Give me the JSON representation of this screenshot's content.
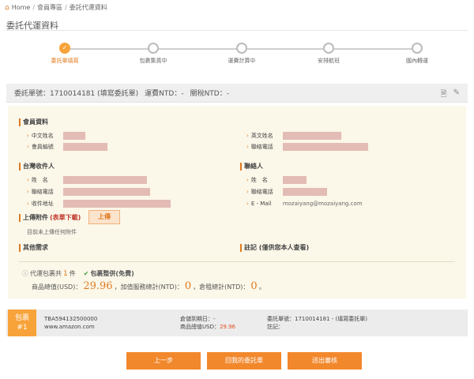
{
  "breadcrumb": {
    "home": "Home",
    "members": "會員專區",
    "current": "委託代運資料"
  },
  "page_title": "委託代運資料",
  "steps": [
    {
      "label": "委託單填寫",
      "active": true
    },
    {
      "label": "包裹集貨中",
      "active": false
    },
    {
      "label": "運費計算中",
      "active": false
    },
    {
      "label": "安排航班",
      "active": false
    },
    {
      "label": "國內轉運",
      "active": false
    }
  ],
  "order_bar": {
    "order_no": "委託單號：1710014181 (填寫委託單)",
    "freight": "運費NTD：-",
    "tax": "關稅NTD：-"
  },
  "member": {
    "title": "會員資料",
    "cn_name_label": "中文姓名",
    "member_no_label": "會員編號",
    "en_name_label": "英文姓名",
    "phone_label": "聯絡電話"
  },
  "receiver": {
    "title": "台灣收件人",
    "name_label": "姓　名",
    "phone_label": "聯絡電話",
    "address_label": "收件地址"
  },
  "contact": {
    "title": "聯絡人",
    "name_label": "姓　名",
    "phone_label": "聯絡電話",
    "email_label": "E - Mail",
    "email_value": "mozaiyang@mozaiyang.com"
  },
  "upload": {
    "title": "上傳附件",
    "link": "(表單下載)",
    "button": "上傳",
    "no_file": "目前未上傳任何附件"
  },
  "other_title": "其他需求",
  "note_title": "註記 (僅供您本人查看)",
  "package_summary": {
    "prefix": "代運包裹共",
    "count": "1",
    "suffix": "件",
    "status": "包裹整併(免費)"
  },
  "totals": {
    "goods_label": "商品總值(USD)：",
    "goods_value": "29.96",
    "service_label": "，加值服務總計(NTD)：",
    "service_value": "0",
    "storage_label": "，倉租總計(NTD)：",
    "storage_value": "0",
    "end": "。"
  },
  "package_row": {
    "badge_top": "包裹",
    "badge_num": "#1",
    "tracking": "TBA594132500000",
    "site": "www.amazon.com",
    "warehouse_label": "倉儲到期日：-",
    "value_label": "商品總值USD：",
    "value_num": "29.96",
    "order_label": "委託單號：1710014181 - (填寫委託單)",
    "note_label": "註記："
  },
  "buttons": {
    "prev": "上一步",
    "back": "回我的委託單",
    "submit": "送出審核"
  }
}
